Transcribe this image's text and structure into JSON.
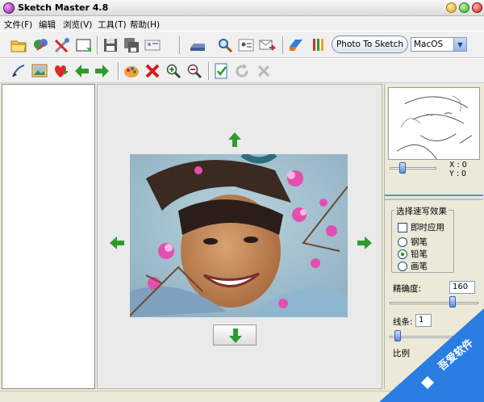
{
  "window": {
    "title": "Sketch Master 4.8"
  },
  "menu": [
    "文件(F)",
    "编辑",
    "浏览(V)",
    "工具(T)",
    "帮助(H)"
  ],
  "toolbar_main": {
    "icons": [
      "open-folder-icon",
      "magic-icon",
      "tools-icon",
      "new-canvas-icon",
      "save-icon",
      "save-all-icon",
      "id-card-icon",
      "scanner-icon",
      "zoom-icon",
      "contact-card-icon",
      "send-mail-icon",
      "swap-icon",
      "brushes-icon"
    ],
    "photo_to_sketch_label": "Photo To Sketch",
    "style_select_value": "MacOS"
  },
  "toolbar_secondary": {
    "icons": [
      "draw-icon",
      "picture-icon",
      "heart-add-icon",
      "arrow-left-icon",
      "arrow-right-icon",
      "palette-icon",
      "delete-icon",
      "zoom-in-icon",
      "zoom-out-icon",
      "apply-icon",
      "redo-icon",
      "cancel-icon"
    ]
  },
  "preview": {
    "coord_x": "X : 0",
    "coord_y": "Y : 0"
  },
  "options": {
    "group_title": "选择速写效果",
    "instant_apply": "即时应用",
    "styles": [
      "钢笔",
      "铅笔",
      "画笔"
    ],
    "selected_style": "铅笔",
    "precision_label": "精确度:",
    "precision_value": "160",
    "lines_label": "线条:",
    "lines_value": "1",
    "ratio_label": "比例"
  },
  "watermark": {
    "text": "吾爱软件"
  },
  "colors": {
    "accent": "#2a7de1",
    "toolbar": "#f0f0f0"
  }
}
